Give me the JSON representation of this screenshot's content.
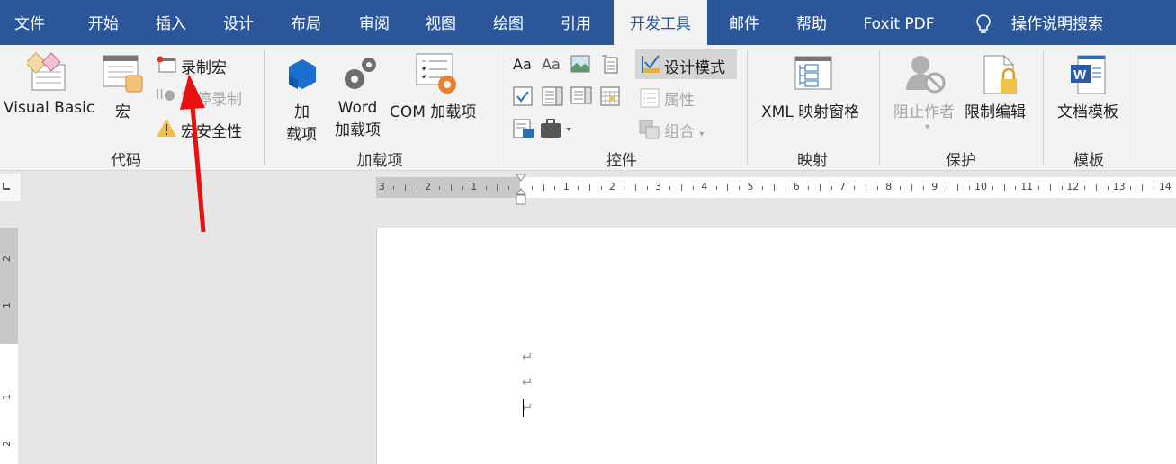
{
  "tabs": [
    {
      "label": "文件",
      "active": false
    },
    {
      "label": "开始",
      "active": false
    },
    {
      "label": "插入",
      "active": false
    },
    {
      "label": "设计",
      "active": false
    },
    {
      "label": "布局",
      "active": false
    },
    {
      "label": "审阅",
      "active": false
    },
    {
      "label": "视图",
      "active": false
    },
    {
      "label": "绘图",
      "active": false
    },
    {
      "label": "引用",
      "active": false
    },
    {
      "label": "开发工具",
      "active": true
    },
    {
      "label": "邮件",
      "active": false
    },
    {
      "label": "帮助",
      "active": false
    },
    {
      "label": "Foxit PDF",
      "active": false
    }
  ],
  "tell_me": {
    "icon": "lightbulb-icon",
    "label": "操作说明搜索"
  },
  "groups": {
    "code": {
      "label": "代码",
      "visual_basic": "Visual Basic",
      "macros": "宏",
      "record_macro": "录制宏",
      "pause_recording": "暂停录制",
      "macro_security": "宏安全性"
    },
    "addins": {
      "label": "加载项",
      "addins_line1": "加",
      "addins_line2": "载项",
      "word_addins_line1": "Word",
      "word_addins_line2": "加载项",
      "com_addins": "COM 加载项"
    },
    "controls": {
      "label": "控件",
      "design_mode": "设计模式",
      "properties": "属性",
      "group": "组合"
    },
    "mapping": {
      "label": "映射",
      "xml_pane": "XML 映射窗格"
    },
    "protect": {
      "label": "保护",
      "block_authors": "阻止作者",
      "restrict_editing": "限制编辑"
    },
    "templates": {
      "label": "模板",
      "document_template": "文档模板"
    }
  },
  "ruler": {
    "left_numbers": [
      "3",
      "2",
      "1"
    ],
    "right_numbers": [
      "1",
      "2",
      "3",
      "4",
      "5",
      "6",
      "7",
      "8",
      "9",
      "10",
      "11",
      "12",
      "13",
      "14"
    ],
    "vertical_numbers": [
      "2",
      "1",
      "1",
      "2"
    ]
  },
  "document": {
    "paragraph_marks": [
      "↵",
      "↵",
      "↵"
    ]
  },
  "colors": {
    "tab_bar": "#2b579a",
    "ribbon": "#f3f3f3",
    "annotation_arrow": "#e81010"
  }
}
